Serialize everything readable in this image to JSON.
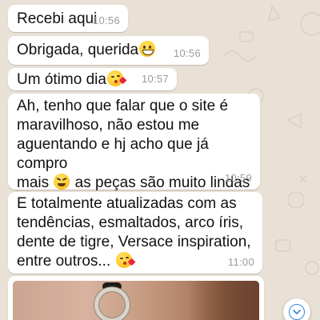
{
  "messages": [
    {
      "text": "Recebi aqui",
      "time": "10:56"
    },
    {
      "text": "Obrigada, querida",
      "emoji": "grinning-face",
      "time": "10:56"
    },
    {
      "text": "Um ótimo dia",
      "emoji": "face-blowing-kiss",
      "time": "10:57"
    },
    {
      "lines": [
        "Ah, tenho que falar que o site é",
        "maravilhoso, não estou me",
        "aguentando e hj acho que já compro"
      ],
      "line4_before": "mais ",
      "line4_emoji": "grinning-squinting-face",
      "line4_after": " as peças são muito lindas",
      "time": "10:59"
    },
    {
      "lines": [
        "E totalmente atualizadas com as",
        "tendências, esmaltados, arco íris,",
        "dente de tigre, Versace inspiration,"
      ],
      "line4_before": "entre outros... ",
      "line4_emoji": "face-blowing-kiss",
      "time": "11:00"
    }
  ],
  "photo": {
    "kind": "image-attachment",
    "subject": "earring"
  },
  "scroll_button": {
    "icon": "chevron-down-icon"
  },
  "colors": {
    "wallpaper": "#e9e1d6",
    "bubble": "#ffffff",
    "timestamp": "#9a9a9a",
    "accent": "#3a86d9"
  }
}
